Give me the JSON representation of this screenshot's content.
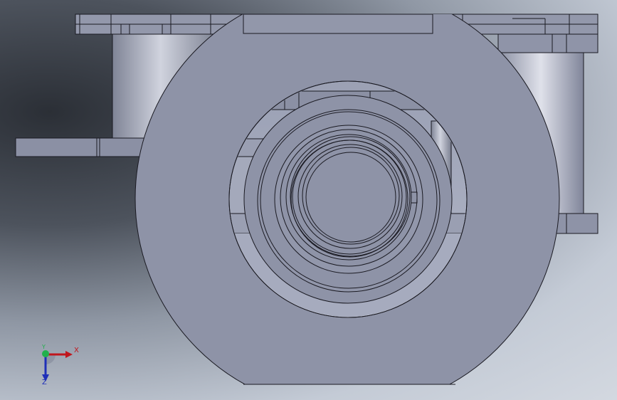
{
  "viewport": {
    "background_dark": "#2b2f36",
    "background_light": "#d3d8e0",
    "model_face_color": "#8e93a7",
    "model_edge_color": "#1a1a22"
  },
  "triad": {
    "x_label": "X",
    "y_label": "Y",
    "z_label": "Z",
    "x_color": "#c0161d",
    "y_color": "#22b14c",
    "z_color": "#1f2fb8"
  }
}
